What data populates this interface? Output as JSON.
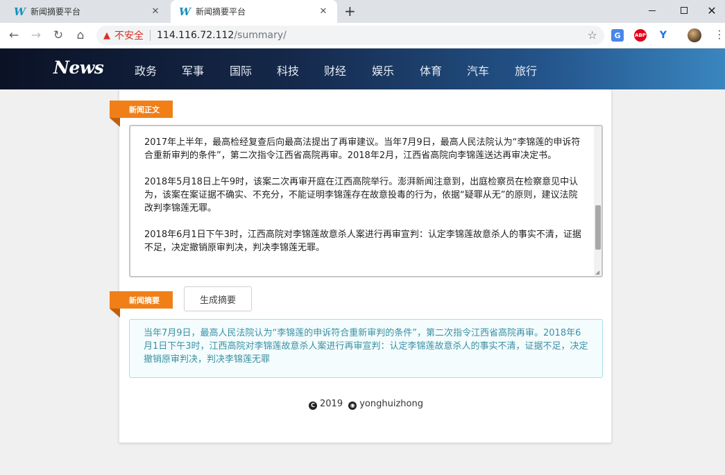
{
  "browser": {
    "tabs": [
      {
        "title": "新闻摘要平台",
        "active": false
      },
      {
        "title": "新闻摘要平台",
        "active": true
      }
    ],
    "new_tab": "+",
    "security_label": "不安全",
    "url_host": "114.116.72.112",
    "url_path": "/summary/",
    "extensions": [
      "translate-icon",
      "adblock-plus-icon",
      "y-extension-icon"
    ]
  },
  "navbar": {
    "logo": "News",
    "items": [
      "政务",
      "军事",
      "国际",
      "科技",
      "财经",
      "娱乐",
      "体育",
      "汽车",
      "旅行"
    ]
  },
  "main": {
    "body_ribbon": "新闻正文",
    "article_paragraphs": [
      "2017年上半年，最高检经复查后向最高法提出了再审建议。当年7月9日，最高人民法院认为“李锦莲的申诉符合重新审判的条件”，第二次指令江西省高院再审。2018年2月，江西省高院向李锦莲送达再审决定书。",
      "2018年5月18日上午9时，该案二次再审开庭在江西高院举行。澎湃新闻注意到，出庭检察员在检察意见中认为，该案在案证据不确实、不充分，不能证明李锦莲存在故意投毒的行为，依据“疑罪从无”的原则，建议法院改判李锦莲无罪。",
      "2018年6月1日下午3时，江西高院对李锦莲故意杀人案进行再审宣判：认定李锦莲故意杀人的事实不清，证据不足，决定撤销原审判决，判决李锦莲无罪。"
    ],
    "summary_ribbon": "新闻摘要",
    "generate_button": "生成摘要",
    "summary_text": "当年7月9日，最高人民法院认为“李锦莲的申诉符合重新审判的条件”，第二次指令江西省高院再审。2018年6月1日下午3时，江西高院对李锦莲故意杀人案进行再审宣判：认定李锦莲故意杀人的事实不清，证据不足，决定撤销原审判决，判决李锦莲无罪"
  },
  "footer": {
    "year": "2019",
    "author": "yonghuizhong"
  },
  "colors": {
    "ribbon": "#f07f18",
    "summary_text": "#3a90a4",
    "summary_border": "#a6dfe6",
    "insecure": "#d93025"
  }
}
